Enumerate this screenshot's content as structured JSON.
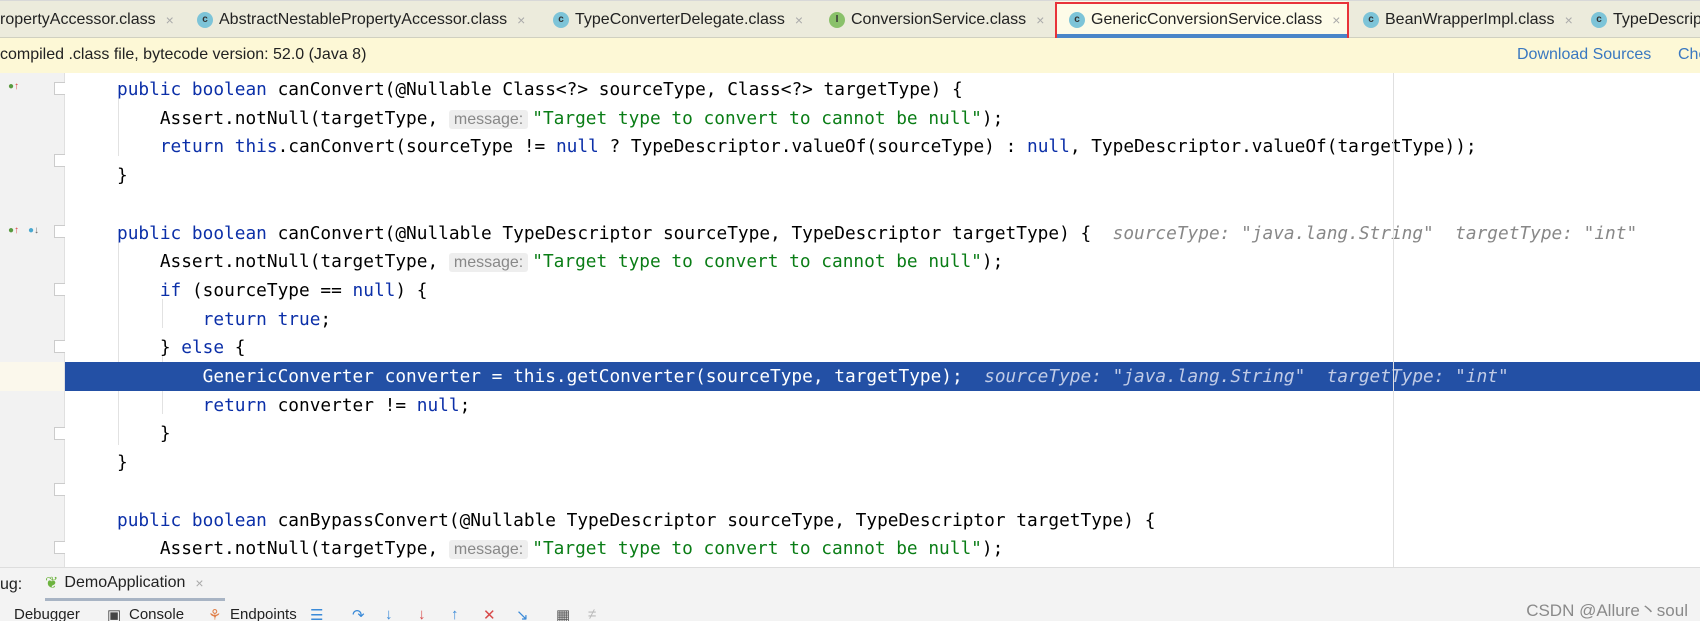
{
  "tabs": [
    {
      "label": "ropertyAccessor.class",
      "icon": "class-icon",
      "icon_letter": "",
      "active": false
    },
    {
      "label": "AbstractNestablePropertyAccessor.class",
      "icon": "class-icon",
      "icon_letter": "c",
      "active": false
    },
    {
      "label": "TypeConverterDelegate.class",
      "icon": "class-icon",
      "icon_letter": "c",
      "active": false
    },
    {
      "label": "ConversionService.class",
      "icon": "interface-icon",
      "icon_letter": "I",
      "active": false
    },
    {
      "label": "GenericConversionService.class",
      "icon": "class-icon",
      "icon_letter": "c",
      "active": true
    },
    {
      "label": "BeanWrapperImpl.class",
      "icon": "class-icon",
      "icon_letter": "c",
      "active": false
    },
    {
      "label": "TypeDescrip",
      "icon": "class-icon",
      "icon_letter": "c",
      "active": false
    }
  ],
  "tab_close_glyph": "×",
  "banner": {
    "message": "compiled .class file, bytecode version: 52.0 (Java 8)",
    "download_sources": "Download Sources",
    "choose_sources": "Che"
  },
  "colors": {
    "highlight": "#2350a5",
    "keyword": "#0b2fa8",
    "string": "#0a7d16",
    "active_tab_underline": "#4a86c8",
    "annotation_box": "#e8333a"
  },
  "code": {
    "highlighted_line": 10,
    "lines": [
      [
        [
          "kw",
          "public boolean "
        ],
        [
          "t",
          "canConvert(@Nullable Class<?> sourceType, Class<?> targetType) {"
        ]
      ],
      [
        [
          "t",
          "    Assert.notNull(targetType, "
        ],
        [
          "param",
          "message:"
        ],
        [
          "str",
          "\"Target type to convert to cannot be null\""
        ],
        [
          "t",
          ");"
        ]
      ],
      [
        [
          "t",
          "    "
        ],
        [
          "kw",
          "return this"
        ],
        [
          "t",
          ".canConvert(sourceType != "
        ],
        [
          "kw",
          "null"
        ],
        [
          "t",
          " ? TypeDescriptor.valueOf(sourceType) : "
        ],
        [
          "kw",
          "null"
        ],
        [
          "t",
          ", TypeDescriptor.valueOf(targetType));"
        ]
      ],
      [
        [
          "t",
          "}"
        ]
      ],
      [],
      [
        [
          "kw",
          "public boolean "
        ],
        [
          "t",
          "canConvert(@Nullable TypeDescriptor sourceType, TypeDescriptor targetType) {  "
        ],
        [
          "hint",
          "sourceType: \"java.lang.String\"  targetType: \"int\""
        ]
      ],
      [
        [
          "t",
          "    Assert.notNull(targetType, "
        ],
        [
          "param",
          "message:"
        ],
        [
          "str",
          "\"Target type to convert to cannot be null\""
        ],
        [
          "t",
          ");"
        ]
      ],
      [
        [
          "t",
          "    "
        ],
        [
          "kw",
          "if"
        ],
        [
          "t",
          " (sourceType == "
        ],
        [
          "kw",
          "null"
        ],
        [
          "t",
          ") {"
        ]
      ],
      [
        [
          "t",
          "        "
        ],
        [
          "kw",
          "return true"
        ],
        [
          "t",
          ";"
        ]
      ],
      [
        [
          "t",
          "    } "
        ],
        [
          "kw",
          "else"
        ],
        [
          "t",
          " {"
        ]
      ],
      [
        [
          "t",
          "        GenericConverter converter = "
        ],
        [
          "kw",
          "this"
        ],
        [
          "t",
          ".getConverter(sourceType, targetType);  "
        ],
        [
          "hint",
          "sourceType: \"java.lang.String\"  targetType: \"int\""
        ]
      ],
      [
        [
          "t",
          "        "
        ],
        [
          "kw",
          "return"
        ],
        [
          "t",
          " converter != "
        ],
        [
          "kw",
          "null"
        ],
        [
          "t",
          ";"
        ]
      ],
      [
        [
          "t",
          "    }"
        ]
      ],
      [
        [
          "t",
          "}"
        ]
      ],
      [],
      [
        [
          "kw",
          "public boolean "
        ],
        [
          "t",
          "canBypassConvert(@Nullable TypeDescriptor sourceType, TypeDescriptor targetType) {"
        ]
      ],
      [
        [
          "t",
          "    Assert.notNull(targetType, "
        ],
        [
          "param",
          "message:"
        ],
        [
          "str",
          "\"Target type to convert to cannot be null\""
        ],
        [
          "t",
          ");"
        ]
      ]
    ]
  },
  "debug": {
    "label": "ug:",
    "session": "DemoApplication",
    "toolbar": {
      "debugger": "Debugger",
      "console": "Console",
      "endpoints": "Endpoints"
    }
  },
  "watermark": "CSDN @Allure丶soul"
}
